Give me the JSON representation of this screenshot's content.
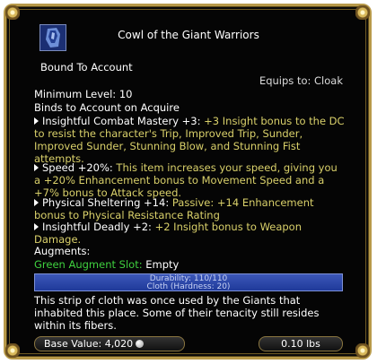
{
  "item": {
    "name": "Cowl of the Giant Warriors",
    "bound": "Bound To Account",
    "equips_to": "Equips to:  Cloak",
    "min_level": "Minimum Level: 10",
    "binds": "Binds to Account on Acquire"
  },
  "effects": [
    {
      "name": "Insightful Combat Mastery +3:",
      "desc": " +3 Insight bonus to the DC to resist the character's Trip, Improved Trip, Sunder, Improved Sunder, Stunning Blow, and Stunning Fist attempts."
    },
    {
      "name": "Speed +20%:",
      "desc": " This item increases your speed, giving you a +20% Enhancement bonus to Movement Speed and a +7% bonus to Attack speed."
    },
    {
      "name": "Physical Sheltering +14:",
      "desc": " Passive: +14 Enhancement bonus to Physical Resistance Rating"
    },
    {
      "name": "Insightful Deadly +2:",
      "desc": " +2 Insight bonus to Weapon Damage."
    }
  ],
  "augments": {
    "label": "Augments:",
    "slot_label": "Green Augment Slot:",
    "slot_value": " Empty"
  },
  "durability": {
    "line1": "Durability: 110/110",
    "line2": "Cloth (Hardness: 20)",
    "fraction": 1.0
  },
  "description": "This strip of cloth was once used by the Giants that inhabited this place. Some of their tenacity still resides within its fibers.",
  "footer": {
    "base_value": "Base Value: 4,020",
    "weight": "0.10 lbs"
  },
  "colors": {
    "frame": "#b89a4a",
    "highlight": "#d9d06a",
    "augment": "#3fd13f",
    "durability": "#2f4aab"
  }
}
